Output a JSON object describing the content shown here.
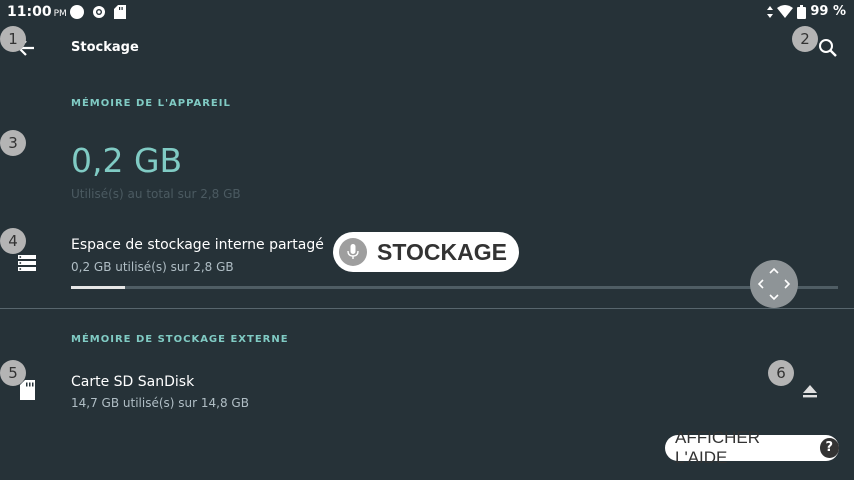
{
  "status_bar": {
    "time": "11:00",
    "ampm": "PM",
    "battery": "99 %",
    "left_icons": [
      "circle-icon",
      "settings-gear-notif-icon",
      "sd-card-notif-icon"
    ],
    "right_icons": [
      "data-arrows-icon",
      "wifi-icon",
      "battery-icon"
    ]
  },
  "toolbar": {
    "title": "Stockage",
    "back_icon": "arrow-back-icon",
    "search_icon": "search-icon"
  },
  "badges": [
    "1",
    "2",
    "3",
    "4",
    "5",
    "6"
  ],
  "device_memory": {
    "header": "MÉMOIRE DE L'APPAREIL",
    "used_value": "0,2 GB",
    "used_total": "Utilisé(s) au total sur 2,8 GB"
  },
  "internal_storage": {
    "title": "Espace de stockage interne partagé",
    "subtitle": "0,2 GB utilisé(s) sur 2,8 GB",
    "usage_fraction": 0.07,
    "icon": "storage-icon"
  },
  "external_storage": {
    "header": "MÉMOIRE DE STOCKAGE EXTERNE",
    "title": "Carte SD SanDisk",
    "subtitle": "14,7 GB utilisé(s) sur 14,8 GB",
    "icon": "sd-card-icon",
    "action_icon": "eject-icon"
  },
  "voice_overlay": {
    "text": "STOCKAGE",
    "icon": "mic-icon"
  },
  "help_button": {
    "label": "AFFICHER L'AIDE",
    "icon": "?"
  },
  "colors": {
    "background": "#263238",
    "accent": "#80cbc4"
  }
}
